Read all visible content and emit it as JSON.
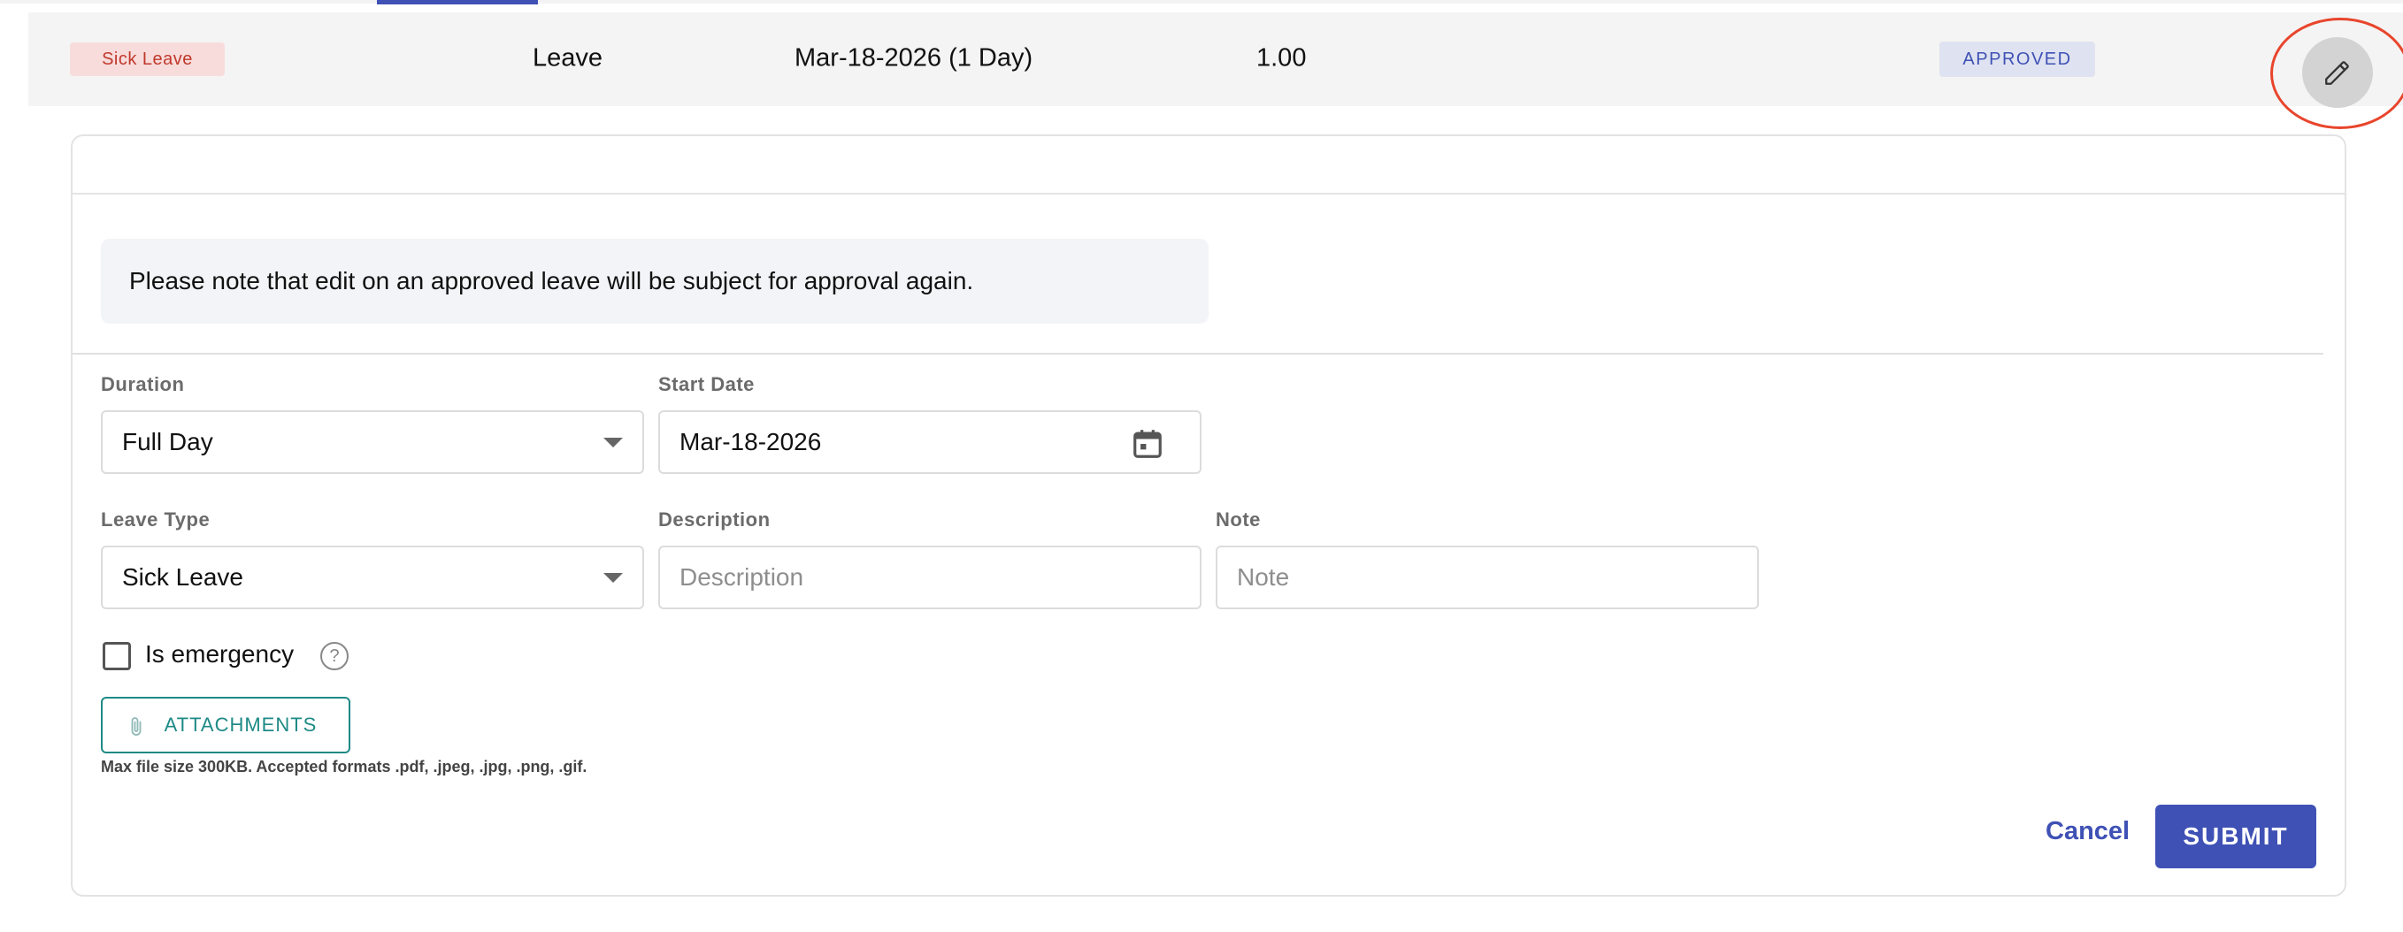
{
  "leave_row": {
    "type_badge": "Sick Leave",
    "category": "Leave",
    "date_range": "Mar-18-2026 (1 Day)",
    "days": "1.00",
    "status": "APPROVED",
    "edit_icon": "pencil-icon"
  },
  "form": {
    "notice": "Please note that edit on an approved leave will be subject for approval again.",
    "duration": {
      "label": "Duration",
      "value": "Full Day"
    },
    "start_date": {
      "label": "Start Date",
      "value": "Mar-18-2026",
      "icon": "calendar-icon"
    },
    "leave_type": {
      "label": "Leave Type",
      "value": "Sick Leave"
    },
    "description": {
      "label": "Description",
      "placeholder": "Description",
      "value": ""
    },
    "note": {
      "label": "Note",
      "placeholder": "Note",
      "value": ""
    },
    "emergency": {
      "label": "Is emergency",
      "checked": false,
      "help_icon": "help-icon"
    },
    "attachments": {
      "label": "ATTACHMENTS",
      "icon": "paperclip-icon",
      "hint": "Max file size 300KB. Accepted formats .pdf, .jpeg, .jpg, .png, .gif."
    },
    "actions": {
      "cancel": "Cancel",
      "submit": "SUBMIT"
    }
  },
  "colors": {
    "primary": "#3f51b5",
    "teal": "#1e8a86",
    "sick_badge_bg": "#f8dcdc",
    "sick_badge_text": "#c0392b",
    "highlight_ring": "#e8452c"
  }
}
